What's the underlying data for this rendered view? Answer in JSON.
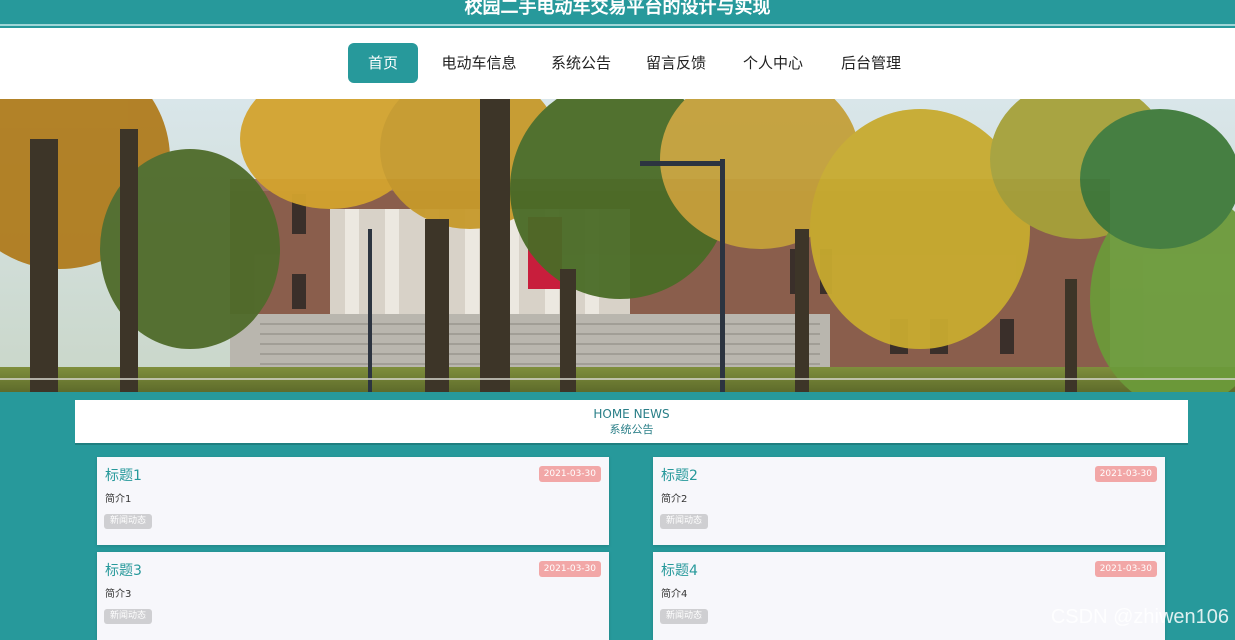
{
  "header": {
    "title": "校园二手电动车交易平台的设计与实现"
  },
  "nav": {
    "items": [
      {
        "label": "首页",
        "active": true
      },
      {
        "label": "电动车信息",
        "active": false
      },
      {
        "label": "系统公告",
        "active": false
      },
      {
        "label": "留言反馈",
        "active": false
      },
      {
        "label": "个人中心",
        "active": false
      },
      {
        "label": "后台管理",
        "active": false
      }
    ]
  },
  "banner": {
    "description": "campus building with autumn trees"
  },
  "news": {
    "heading_en": "HOME NEWS",
    "heading_cn": "系统公告",
    "cards": [
      {
        "title": "标题1",
        "date": "2021-03-30",
        "intro": "简介1",
        "tag": "新闻动态"
      },
      {
        "title": "标题2",
        "date": "2021-03-30",
        "intro": "简介2",
        "tag": "新闻动态"
      },
      {
        "title": "标题3",
        "date": "2021-03-30",
        "intro": "简介3",
        "tag": "新闻动态"
      },
      {
        "title": "标题4",
        "date": "2021-03-30",
        "intro": "简介4",
        "tag": "新闻动态"
      }
    ]
  },
  "watermark": "CSDN @zhiwen106",
  "colors": {
    "accent": "#27999b",
    "date_badge": "#f2a7a7",
    "tag_badge": "#cfcfd2"
  }
}
